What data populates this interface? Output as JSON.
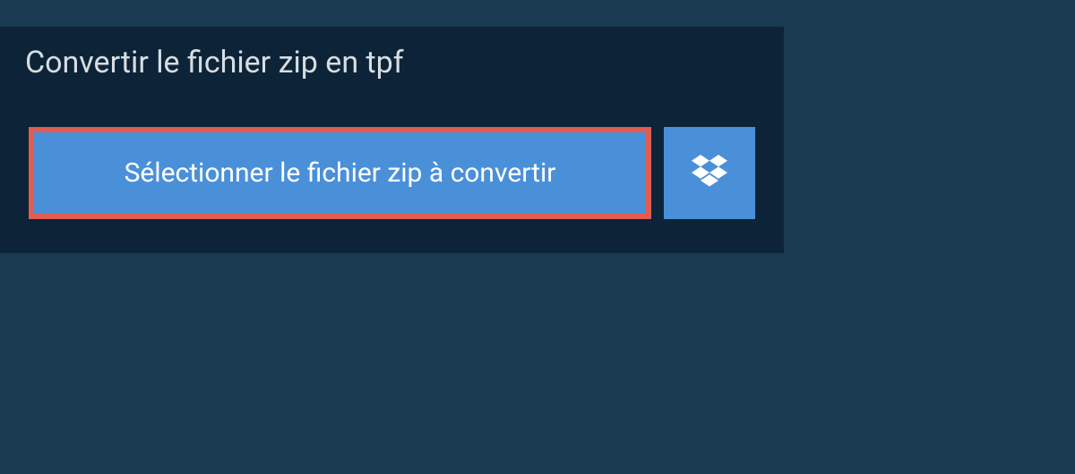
{
  "title": "Convertir le fichier zip en tpf",
  "buttons": {
    "select_file_label": "Sélectionner le fichier zip à convertir"
  },
  "icons": {
    "dropbox": "dropbox-icon"
  },
  "colors": {
    "background": "#1a3a52",
    "panel": "#0d2438",
    "button": "#4a90d9",
    "highlight_border": "#e15d52",
    "text_light": "#d8dde2",
    "text_white": "#ffffff"
  }
}
